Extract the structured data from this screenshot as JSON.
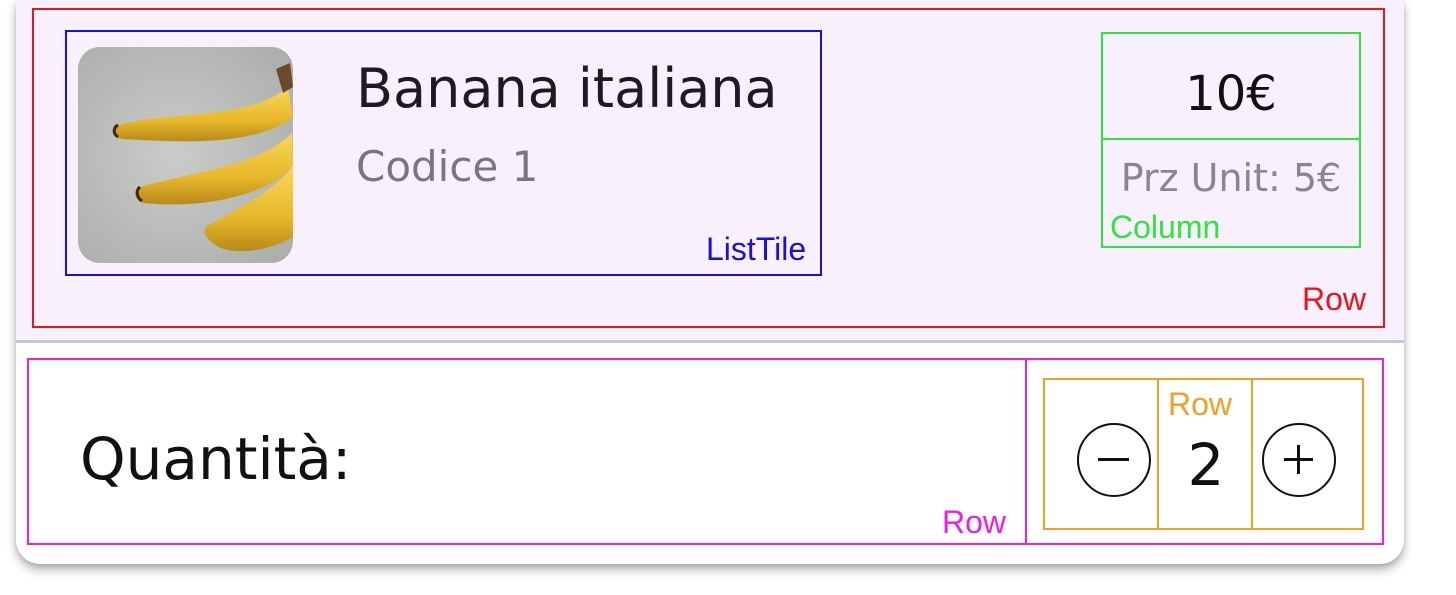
{
  "product": {
    "name": "Banana italiana",
    "code": "Codice 1",
    "price": "10€",
    "unit_price": "Prz Unit: 5€",
    "image": "banana-photo"
  },
  "quantity": {
    "label": "Quantità:",
    "value": "2",
    "decrement_icon": "minus-circle-icon",
    "increment_icon": "plus-circle-icon"
  },
  "debug_labels": {
    "list_tile": "ListTile",
    "column": "Column",
    "top_row": "Row",
    "quantity_row": "Row",
    "stepper_row": "Row"
  },
  "colors": {
    "card_top_background": "#f8f0fd",
    "row_outline": "#e8141e",
    "listtile_outline": "#1a10d8",
    "column_outline": "#2ee63a",
    "quantity_row_outline": "#ee1ee0",
    "stepper_row_outline": "#f0a025"
  }
}
